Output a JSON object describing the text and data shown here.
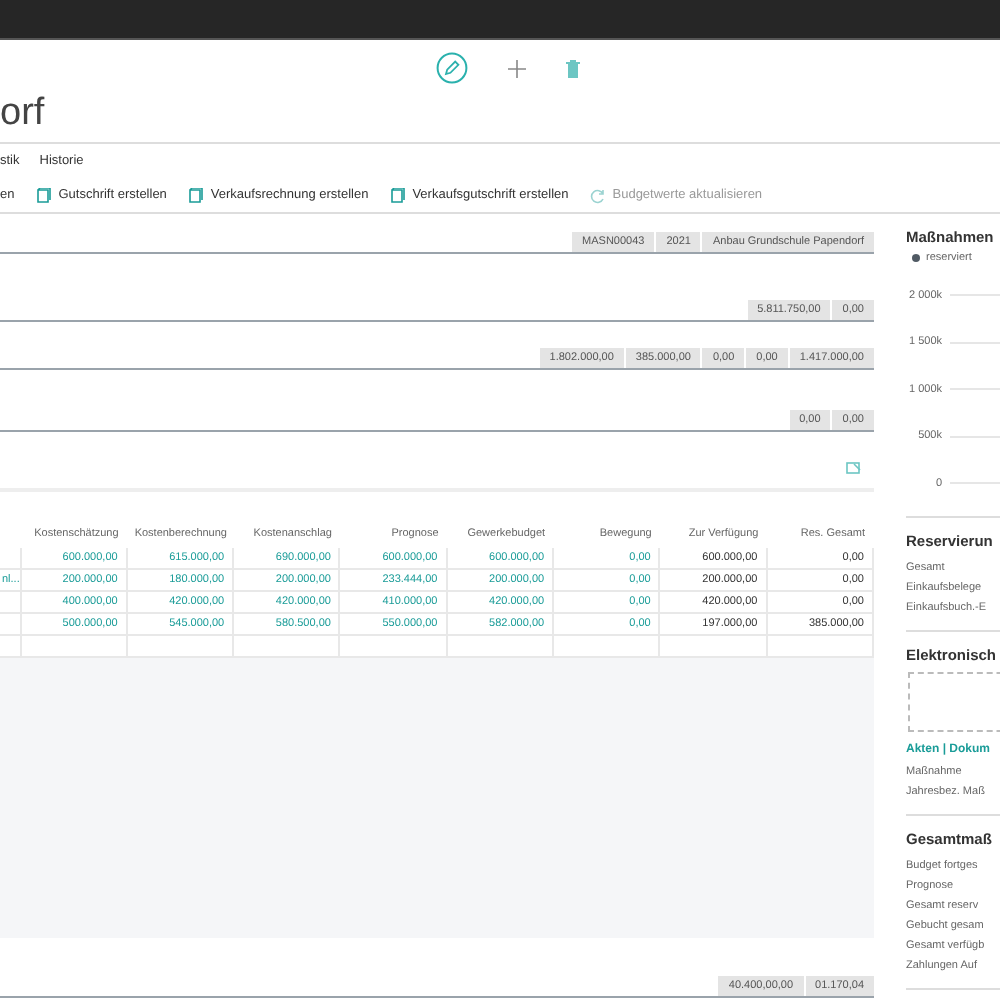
{
  "page_title": "orf",
  "tabs": [
    {
      "label": "stik",
      "selected": false
    },
    {
      "label": "Historie",
      "selected": false
    }
  ],
  "actions": [
    {
      "label": "en",
      "kind": "text",
      "disabled": false
    },
    {
      "label": "Gutschrift erstellen",
      "kind": "document",
      "disabled": false
    },
    {
      "label": "Verkaufsrechnung erstellen",
      "kind": "document",
      "disabled": false
    },
    {
      "label": "Verkaufsgutschrift erstellen",
      "kind": "document",
      "disabled": false
    },
    {
      "label": "Budgetwerte aktualisieren",
      "kind": "refresh",
      "disabled": true
    }
  ],
  "field_groups": [
    {
      "chips": [
        "MASN00043",
        "2021",
        "Anbau Grundschule Papendorf"
      ]
    },
    {
      "chips": [
        "5.811.750,00",
        "0,00"
      ]
    },
    {
      "chips": [
        "1.802.000,00",
        "385.000,00",
        "0,00",
        "0,00",
        "1.417.000,00"
      ]
    },
    {
      "chips": [
        "0,00",
        "0,00"
      ]
    }
  ],
  "lines": {
    "columns": [
      {
        "label": "Kostenschätzung",
        "kind": "link"
      },
      {
        "label": "Kostenberechnung",
        "kind": "link"
      },
      {
        "label": "Kostenanschlag",
        "kind": "link"
      },
      {
        "label": "Prognose",
        "kind": "link"
      },
      {
        "label": "Gewerkebudget",
        "kind": "link"
      },
      {
        "label": "Bewegung",
        "kind": "link"
      },
      {
        "label": "Zur Verfügung",
        "kind": "plain"
      },
      {
        "label": "Res. Gesamt",
        "kind": "plain"
      }
    ],
    "rows": [
      {
        "cells": [
          "600.000,00",
          "615.000,00",
          "690.000,00",
          "600.000,00",
          "600.000,00",
          "0,00",
          "600.000,00",
          "0,00"
        ]
      },
      {
        "column_1": "nl...",
        "cells": [
          "200.000,00",
          "180.000,00",
          "200.000,00",
          "233.444,00",
          "200.000,00",
          "0,00",
          "200.000,00",
          "0,00"
        ]
      },
      {
        "cells": [
          "400.000,00",
          "420.000,00",
          "420.000,00",
          "410.000,00",
          "420.000,00",
          "0,00",
          "420.000,00",
          "0,00"
        ]
      },
      {
        "cells": [
          "500.000,00",
          "545.000,00",
          "580.500,00",
          "550.000,00",
          "582.000,00",
          "0,00",
          "197.000,00",
          "385.000,00"
        ]
      }
    ]
  },
  "footer_chips": [
    "40.400,00,00",
    "01.170,04"
  ],
  "side_panel": {
    "chart": {
      "title": "Maßnahmen",
      "legend": "reserviert",
      "color": "#505a64",
      "ticks": [
        "2 000k",
        "1 500k",
        "1 000k",
        "500k",
        "0"
      ]
    },
    "sections": [
      {
        "title": "Reservierun",
        "lines": [
          "Gesamt",
          "Einkaufsbelege",
          "Einkaufsbuch.-E"
        ]
      },
      {
        "title": "Elektronisch",
        "link": "Akten | Dokum",
        "lines": [
          "Maßnahme",
          "Jahresbez. Maß"
        ]
      },
      {
        "title": "Gesamtmaß",
        "lines": [
          "Budget fortges",
          "Prognose",
          "Gesamt reserv",
          "Gebucht gesam",
          "Gesamt verfügb",
          "Zahlungen Auf"
        ]
      }
    ]
  }
}
